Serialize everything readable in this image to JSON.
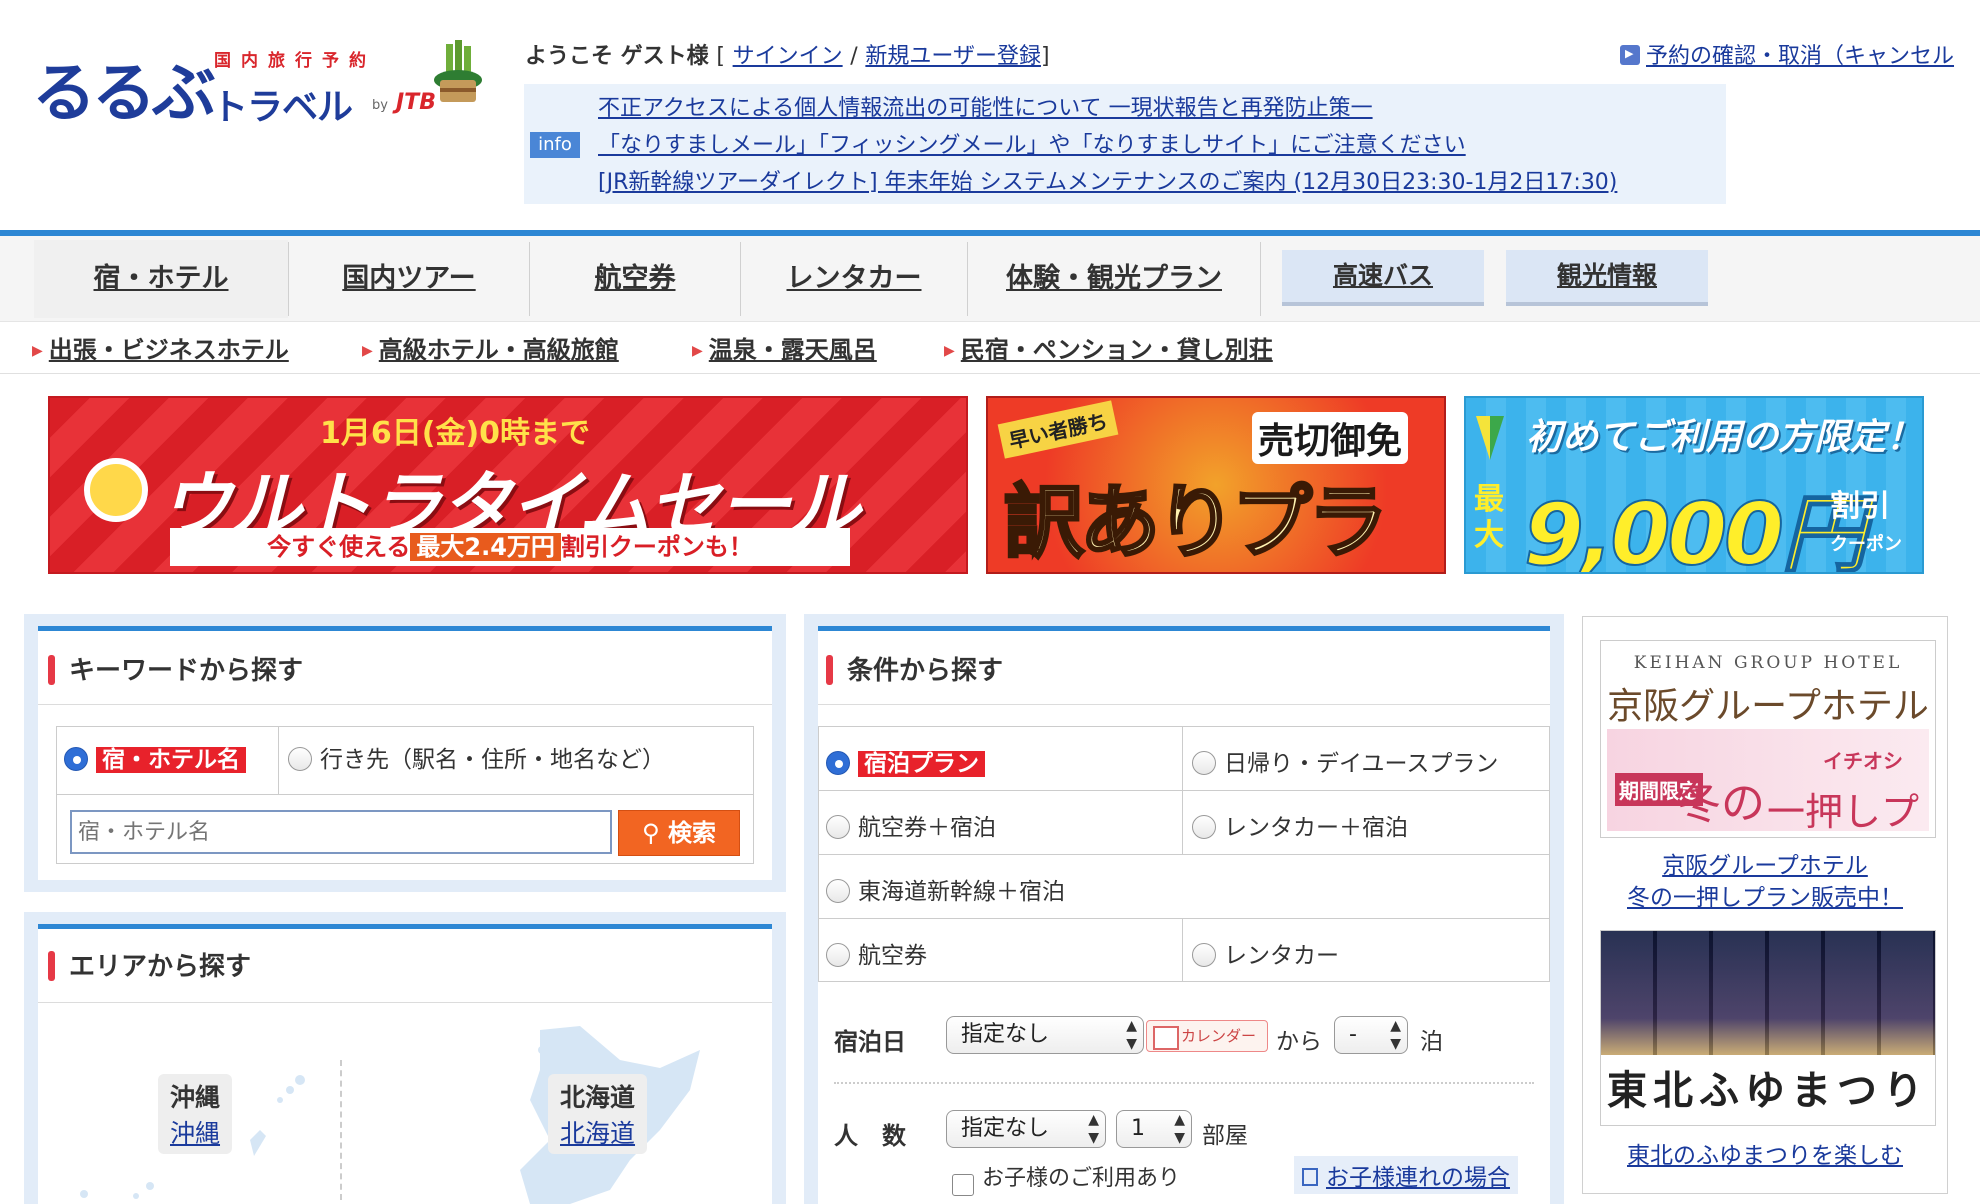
{
  "header": {
    "logo_main": "るるぶ",
    "logo_sub": "国内旅行予約",
    "logo_travel": "トラベル",
    "logo_by": "by",
    "logo_jtb": "JTB",
    "welcome_prefix": "ようこそ ゲスト様",
    "bracket_open": "[",
    "signin": "サインイン",
    "slash": "/",
    "register": "新規ユーザー登録",
    "bracket_close": "]",
    "reservation_link": "予約の確認・取消（キャンセル"
  },
  "info": {
    "badge": "info",
    "notices": [
      "不正アクセスによる個人情報流出の可能性について 一現状報告と再発防止策一",
      "「なりすましメール」「フィッシングメール」や「なりすましサイト」にご注意ください",
      "[JR新幹線ツアーダイレクト] 年末年始 システムメンテナンスのご案内 (12月30日23:30-1月2日17:30)"
    ]
  },
  "nav": {
    "tabs": [
      "宿・ホテル",
      "国内ツアー",
      "航空券",
      "レンタカー",
      "体験・観光プラン"
    ],
    "buttons": [
      "高速バス",
      "観光情報"
    ],
    "active_index": 0
  },
  "subnav": [
    "出張・ビジネスホテル",
    "高級ホテル・高級旅館",
    "温泉・露天風呂",
    "民宿・ペンション・貸し別荘"
  ],
  "banners": {
    "sale": {
      "top": "1月6日(金)0時まで",
      "main": "ウルトラタイムセール",
      "bottom_pre": "今すぐ使える",
      "bottom_max": "最大2.4万円",
      "bottom_post": "割引クーポンも！"
    },
    "plan": {
      "tag": "早い者勝ち",
      "sold": "売切御免",
      "main": "訳ありプラン"
    },
    "first": {
      "top": "初めてご利用の方限定！",
      "max": "最大",
      "main": "9,000円",
      "side1": "割引",
      "side2": "クーポン"
    }
  },
  "keyword": {
    "title": "キーワードから探す",
    "option1": "宿・ホテル名",
    "option2": "行き先（駅名・住所・地名など）",
    "placeholder": "宿・ホテル名",
    "search_button": "検索"
  },
  "area": {
    "title": "エリアから探す",
    "regions": [
      {
        "name": "沖縄",
        "link": "沖縄"
      },
      {
        "name": "北海道",
        "link": "北海道"
      }
    ]
  },
  "conditions": {
    "title": "条件から探す",
    "options": [
      "宿泊プラン",
      "日帰り・デイユースプラン",
      "航空券＋宿泊",
      "レンタカー＋宿泊",
      "東海道新幹線＋宿泊",
      "航空券",
      "レンタカー"
    ],
    "date_label": "宿泊日",
    "date_value": "指定なし",
    "calendar": "カレンダー",
    "from": "から",
    "nights_value": "-",
    "nights_unit": "泊",
    "people_label": "人　数",
    "people_value": "指定なし",
    "rooms_value": "1",
    "rooms_unit": "部屋",
    "child_check": "お子様のご利用あり",
    "child_link": "お子様連れの場合"
  },
  "ads": {
    "ad1": {
      "brand": "KEIHAN GROUP HOTEL",
      "name": "京阪グループホテル",
      "badge": "期間限定",
      "winter": "冬の",
      "ichioshi": "イチオシ",
      "push": "一押しプラン",
      "link1": "京阪グループホテル",
      "link2": "冬の一押しプラン販売中！"
    },
    "ad2": {
      "caption": "東北ふゆまつり",
      "link": "東北のふゆまつりを楽しむ"
    }
  },
  "colors": {
    "accent_blue": "#2d87d4",
    "brand_navy": "#1e3c9a",
    "red": "#e8222b",
    "search_orange": "#f26522",
    "link": "#1a3a9c"
  }
}
